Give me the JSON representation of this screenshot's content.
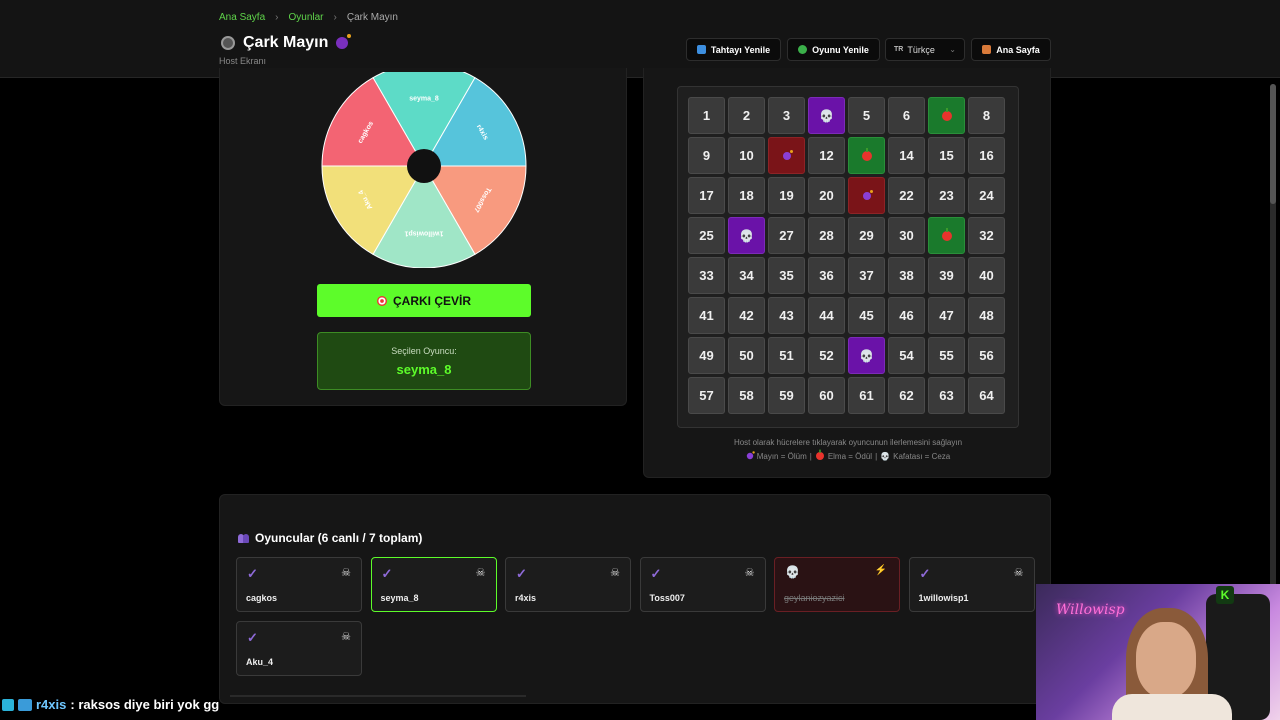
{
  "breadcrumbs": [
    "Ana Sayfa",
    "Oyunlar",
    "Çark Mayın"
  ],
  "header": {
    "title": "Çark Mayın",
    "subtitle": "Host Ekranı",
    "buttons": {
      "reset_board": "Tahtayı Yenile",
      "reset_game": "Oyunu Yenile",
      "home": "Ana Sayfa"
    },
    "language": {
      "code": "TR",
      "label": "Türkçe"
    }
  },
  "wheel": {
    "segments": [
      "seyma_8",
      "r4xis",
      "Toss007",
      "1willowisp1",
      "Aku_4",
      "cagkos"
    ],
    "colors": [
      "#5ddbc7",
      "#56c4db",
      "#f89a7f",
      "#a0e6c7",
      "#f2e07a",
      "#f36473"
    ],
    "spin_label": "ÇARKI ÇEVİR",
    "selected_label": "Seçilen Oyuncu:",
    "selected_player": "seyma_8"
  },
  "board": {
    "cells": [
      "1",
      "2",
      "3",
      "",
      "5",
      "6",
      "",
      "8",
      "9",
      "10",
      "",
      "12",
      "",
      "14",
      "15",
      "16",
      "17",
      "18",
      "19",
      "20",
      "",
      "22",
      "23",
      "24",
      "25",
      "",
      "27",
      "28",
      "29",
      "30",
      "",
      "32",
      "33",
      "34",
      "35",
      "36",
      "37",
      "38",
      "39",
      "40",
      "41",
      "42",
      "43",
      "44",
      "45",
      "46",
      "47",
      "48",
      "49",
      "50",
      "51",
      "52",
      "",
      "54",
      "55",
      "56",
      "57",
      "58",
      "59",
      "60",
      "61",
      "62",
      "63",
      "64"
    ],
    "states": [
      "n",
      "n",
      "n",
      "skull",
      "n",
      "n",
      "apple",
      "n",
      "n",
      "n",
      "bomb",
      "n",
      "apple",
      "n",
      "n",
      "n",
      "n",
      "n",
      "n",
      "n",
      "bomb",
      "n",
      "n",
      "n",
      "n",
      "skull",
      "n",
      "n",
      "n",
      "n",
      "apple",
      "n",
      "n",
      "n",
      "n",
      "n",
      "n",
      "n",
      "n",
      "n",
      "n",
      "n",
      "n",
      "n",
      "n",
      "n",
      "n",
      "n",
      "n",
      "n",
      "n",
      "n",
      "skull",
      "n",
      "n",
      "n",
      "n",
      "n",
      "n",
      "n",
      "n",
      "n",
      "n",
      "n"
    ],
    "hint": "Host olarak hücrelere tıklayarak oyuncunun ilerlemesini sağlayın",
    "legend": {
      "mine": "Mayın = Ölüm",
      "apple": "Elma = Ödül",
      "skull": "Kafatası = Ceza"
    }
  },
  "players": {
    "title": "Oyuncular (6 canlı / 7 toplam)",
    "list": [
      {
        "name": "cagkos",
        "status": "alive"
      },
      {
        "name": "seyma_8",
        "status": "active"
      },
      {
        "name": "r4xis",
        "status": "alive"
      },
      {
        "name": "Toss007",
        "status": "alive"
      },
      {
        "name": "geylaniozyazici",
        "status": "dead"
      },
      {
        "name": "1willowisp1",
        "status": "alive"
      },
      {
        "name": "Aku_4",
        "status": "alive"
      }
    ]
  },
  "chat": {
    "user": "r4xis",
    "message": ": raksos diye biri yok gg"
  },
  "webcam": {
    "neon_text": "Willowisp",
    "logo": "K"
  }
}
